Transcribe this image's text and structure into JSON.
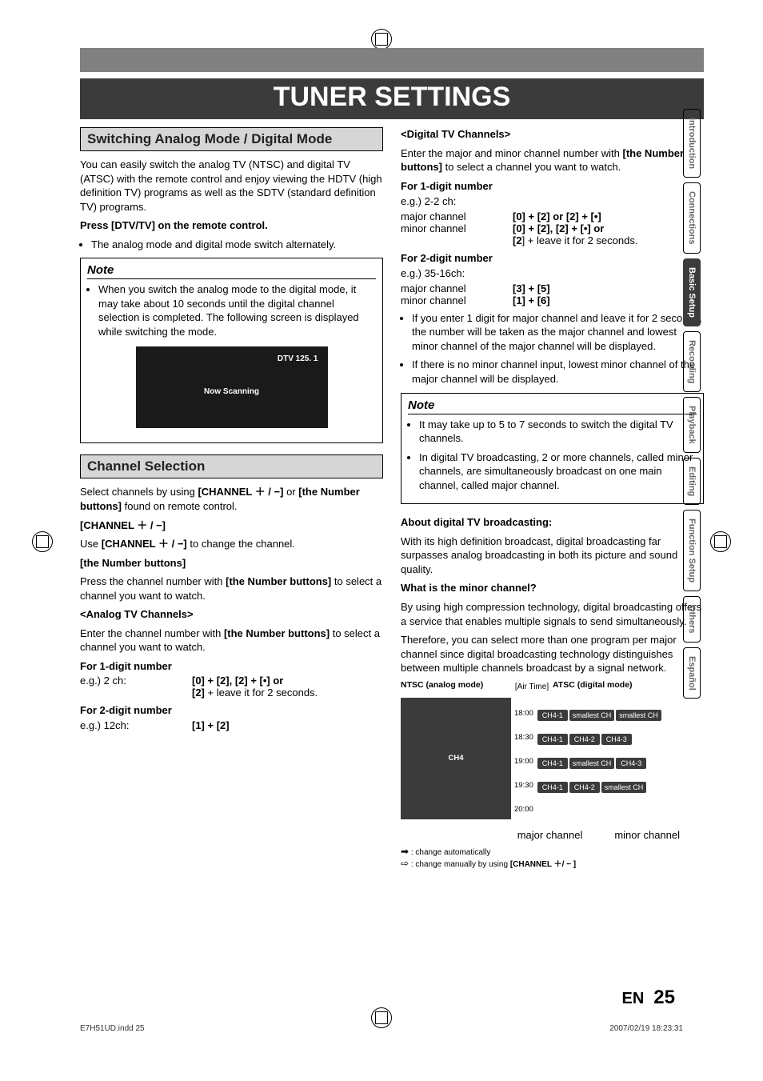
{
  "title": "TUNER SETTINGS",
  "left": {
    "sec1_title": "Switching Analog Mode / Digital Mode",
    "sec1_p1": "You can easily switch the analog TV (NTSC) and digital TV (ATSC) with the remote control and enjoy viewing the HDTV (high definition TV) programs as well as the SDTV (standard definition TV) programs.",
    "sec1_press": "Press [DTV/TV] on the remote control.",
    "sec1_bul": "The analog mode and digital mode switch alternately.",
    "note1_title": "Note",
    "note1_b1": "When you switch the analog mode to the digital mode, it may take about 10 seconds until the digital channel selection is completed. The following screen is displayed while switching the mode.",
    "screen_hdr": "DTV 125. 1",
    "screen_mid": "Now Scanning",
    "sec2_title": "Channel Selection",
    "sec2_p1a": "Select channels by using ",
    "sec2_p1b": "[CHANNEL ＋ / −]",
    "sec2_p1c": " or ",
    "sec2_p1d": "[the Number buttons]",
    "sec2_p1e": " found on remote control.",
    "sec2_h1": "[CHANNEL ＋ / −]",
    "sec2_p2a": "Use ",
    "sec2_p2b": "[CHANNEL ＋ / −]",
    "sec2_p2c": " to change the channel.",
    "sec2_h2": "[the Number buttons]",
    "sec2_p3a": "Press the channel number with ",
    "sec2_p3b": "[the Number buttons]",
    "sec2_p3c": " to select a channel you want to watch.",
    "sec2_h3": "<Analog TV Channels>",
    "sec2_p4a": "Enter the channel number with ",
    "sec2_p4b": "[the Number buttons]",
    "sec2_p4c": " to select a channel you want to watch.",
    "sec2_h4": "For 1-digit number",
    "sec2_r1l": "e.g.) 2 ch:",
    "sec2_r1m": "[0] + [2], [2] + [•] or",
    "sec2_r1n": "[2] + leave it for 2 seconds.",
    "sec2_h5": "For 2-digit number",
    "sec2_r2l": "e.g.) 12ch:",
    "sec2_r2m": "[1] + [2]"
  },
  "right": {
    "h1": "<Digital TV Channels>",
    "p1a": "Enter the major and minor channel number with ",
    "p1b": "[the Number buttons]",
    "p1c": " to select a channel you want to watch.",
    "h2": "For 1-digit number",
    "r1": "e.g.) 2-2 ch:",
    "r2l": "major channel",
    "r2m": "[0] + [2] or [2] + [•]",
    "r3l": "minor channel",
    "r3m": "[0] + [2], [2] + [•] or",
    "r3n": "[2] + leave it for 2 seconds.",
    "h3": "For 2-digit number",
    "r4": "e.g.) 35-16ch:",
    "r5l": "major channel",
    "r5m": "[3] + [5]",
    "r6l": "minor channel",
    "r6m": "[1] + [6]",
    "b1": "If you enter 1 digit for major channel and leave it for 2 seconds, the number will be taken as the major channel and lowest minor channel of the major channel will be displayed.",
    "b2": "If there is no minor channel input, lowest minor channel of the major channel will be displayed.",
    "note_title": "Note",
    "nb1": "It may take up to 5 to 7 seconds to switch the digital TV channels.",
    "nb2": "In digital TV broadcasting, 2 or more channels, called minor channels, are simultaneously broadcast on one main channel, called major channel.",
    "h4": "About digital TV broadcasting:",
    "p4": "With its high definition broadcast, digital broadcasting far surpasses analog broadcasting in both its picture and sound quality.",
    "h5": "What is the minor channel?",
    "p5": "By using high compression technology, digital broadcasting offers a service that enables multiple signals to send simultaneously.",
    "p6": "Therefore, you can select more than one program per major channel since digital broadcasting technology distinguishes between multiple channels broadcast by a signal network.",
    "diag": {
      "ntsc_head": "NTSC (analog mode)",
      "atsc_head": "ATSC (digital mode)",
      "airtime": "[Air Time]",
      "times": [
        "18:00",
        "18:30",
        "19:00",
        "19:30",
        "20:00"
      ],
      "ch4": "CH4",
      "cells": [
        "CH4-1",
        "smallest CH",
        "smallest CH",
        "CH4-1",
        "CH4-2",
        "CH4-3",
        "CH4-1",
        "smallest CH",
        "CH4-3",
        "CH4-1",
        "CH4-2",
        "smallest CH"
      ],
      "major_lab": "major channel",
      "minor_lab": "minor channel"
    },
    "leg1": " : change automatically",
    "leg2a": " : change manually by using ",
    "leg2b": "[CHANNEL ＋/ − ]"
  },
  "tabs": [
    "Introduction",
    "Connections",
    "Basic Setup",
    "Recording",
    "Playback",
    "Editing",
    "Function Setup",
    "Others",
    "Español"
  ],
  "tabs_active_index": 2,
  "page_en": "EN",
  "page_no": "25",
  "foot_l": "E7H51UD.indd   25",
  "foot_r": "2007/02/19   18:23:31"
}
